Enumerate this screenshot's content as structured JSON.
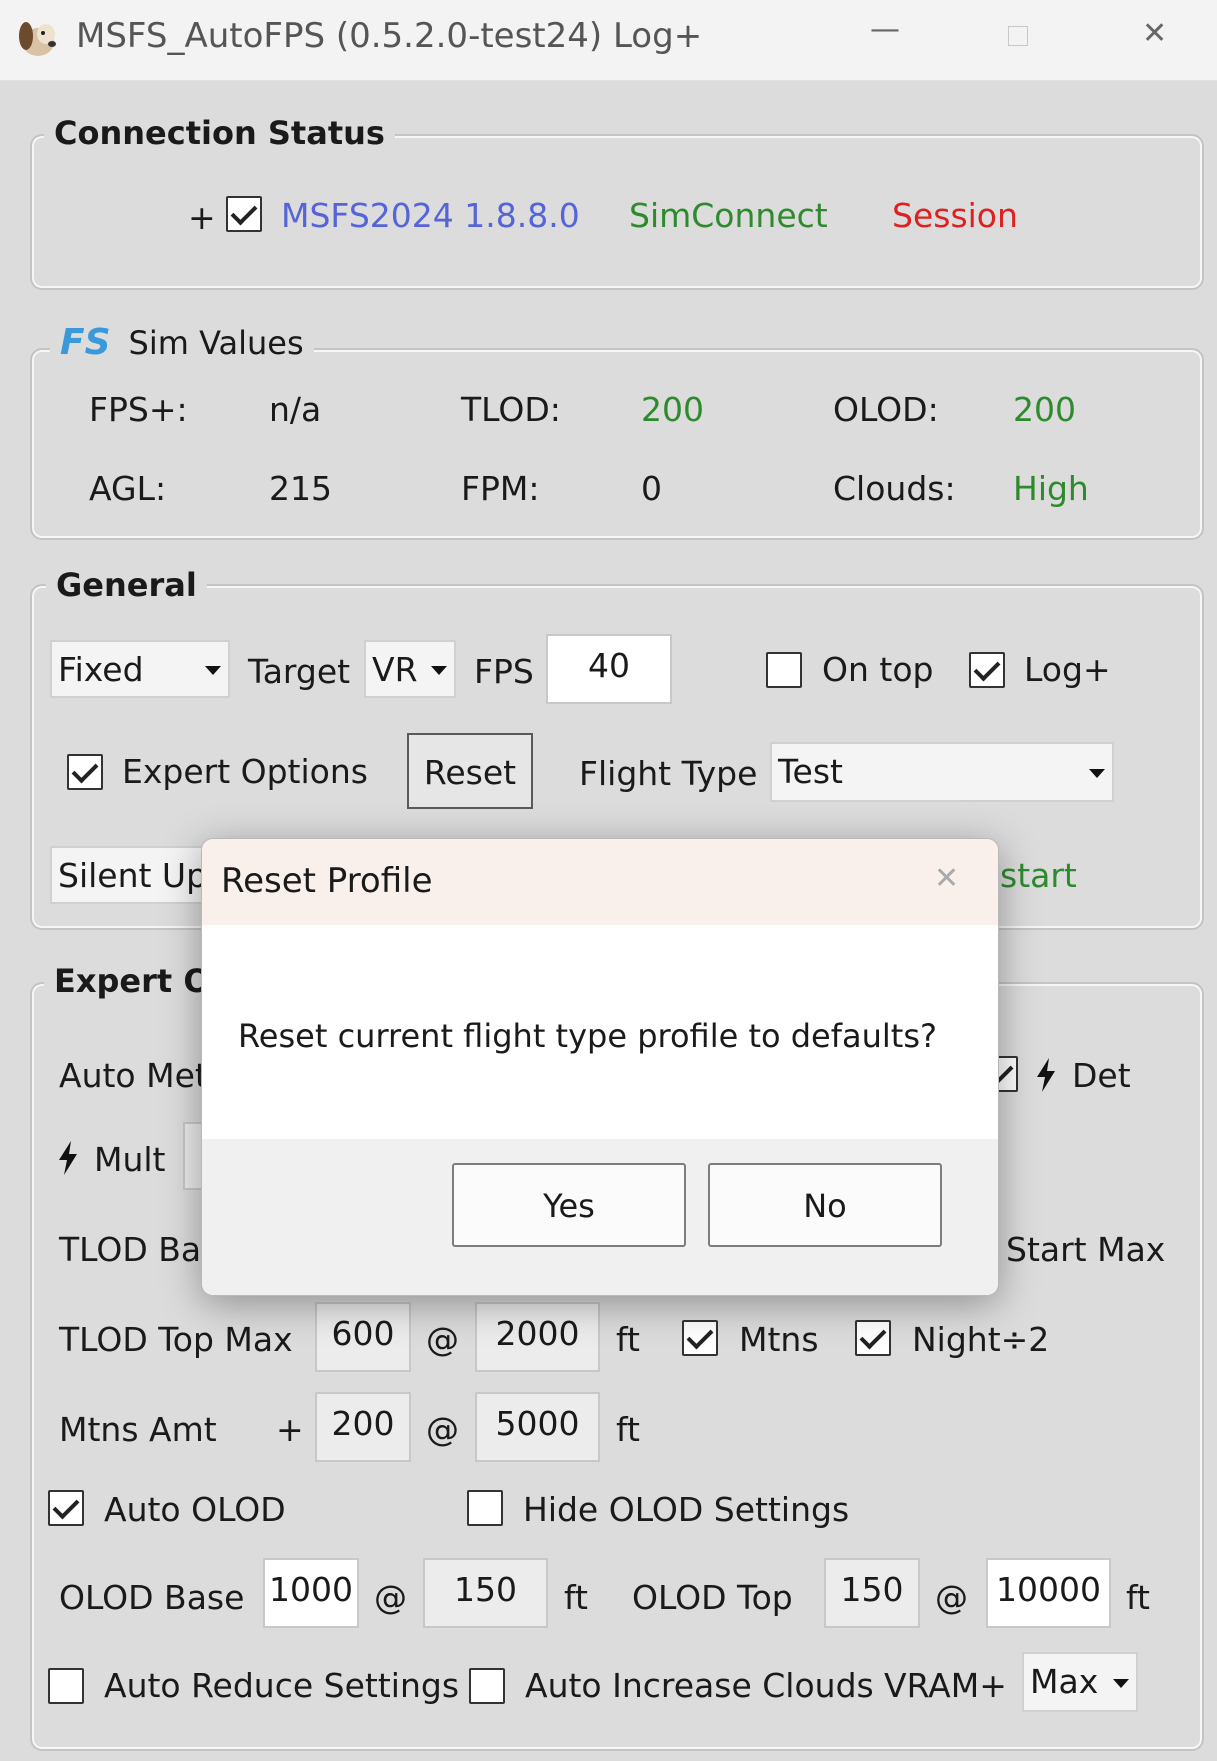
{
  "window": {
    "title": "MSFS_AutoFPS (0.5.2.0-test24) Log+",
    "minimize_icon": "minimize-icon",
    "maximize_icon": "maximize-icon",
    "close_icon": "close-icon"
  },
  "connection": {
    "legend": "Connection Status",
    "plus": "+",
    "sim_checked": true,
    "sim_label": "MSFS2024 1.8.8.0",
    "simconnect_label": "SimConnect",
    "session_label": "Session"
  },
  "sim_values": {
    "legend": "Sim Values",
    "logo_text": "FS",
    "fps_label": "FPS+:",
    "fps_value": "n/a",
    "tlod_label": "TLOD:",
    "tlod_value": "200",
    "olod_label": "OLOD:",
    "olod_value": "200",
    "agl_label": "AGL:",
    "agl_value": "215",
    "fpm_label": "FPM:",
    "fpm_value": "0",
    "clouds_label": "Clouds:",
    "clouds_value": "High"
  },
  "general": {
    "legend": "General",
    "mode_value": "Fixed",
    "target_label": "Target",
    "target_value": "VR",
    "fps_label": "FPS",
    "fps_value": "40",
    "on_top_label": "On top",
    "on_top_checked": false,
    "logplus_label": "Log+",
    "logplus_checked": true,
    "expert_label": "Expert Options",
    "expert_checked": true,
    "reset_label": "Reset",
    "flight_type_label": "Flight Type",
    "flight_type_value": "Test",
    "silent_partial": "Silent Up",
    "restart_partial": "start"
  },
  "expert": {
    "legend_partial": "Expert Op",
    "auto_met_partial": "Auto Met",
    "det_label": "Det",
    "mult_label": "Mult",
    "tlod_base_partial": "TLOD Bas",
    "start_max_label": "Start Max",
    "tlod_top_label": "TLOD Top Max",
    "tlod_top_value": "600",
    "at1": "@",
    "tlod_top_alt": "2000",
    "ft1": "ft",
    "mtns_label": "Mtns",
    "mtns_checked": true,
    "night_label": "Night÷2",
    "night_checked": true,
    "mtns_amt_label": "Mtns Amt",
    "plus": "+",
    "mtns_amt_value": "200",
    "at2": "@",
    "mtns_amt_alt": "5000",
    "ft2": "ft",
    "auto_olod_label": "Auto OLOD",
    "auto_olod_checked": true,
    "hide_olod_label": "Hide OLOD Settings",
    "hide_olod_checked": false,
    "olod_base_label": "OLOD Base",
    "olod_base_value": "1000",
    "at3": "@",
    "olod_base_alt": "150",
    "ft3": "ft",
    "olod_top_label": "OLOD Top",
    "olod_top_value": "150",
    "at4": "@",
    "olod_top_alt": "10000",
    "ft4": "ft",
    "auto_reduce_label": "Auto Reduce Settings",
    "auto_reduce_checked": false,
    "auto_clouds_label": "Auto Increase Clouds",
    "auto_clouds_checked": false,
    "vram_label": "VRAM+",
    "vram_value": "Max"
  },
  "dialog": {
    "title": "Reset Profile",
    "message": "Reset current flight type profile to defaults?",
    "yes_label": "Yes",
    "no_label": "No"
  }
}
